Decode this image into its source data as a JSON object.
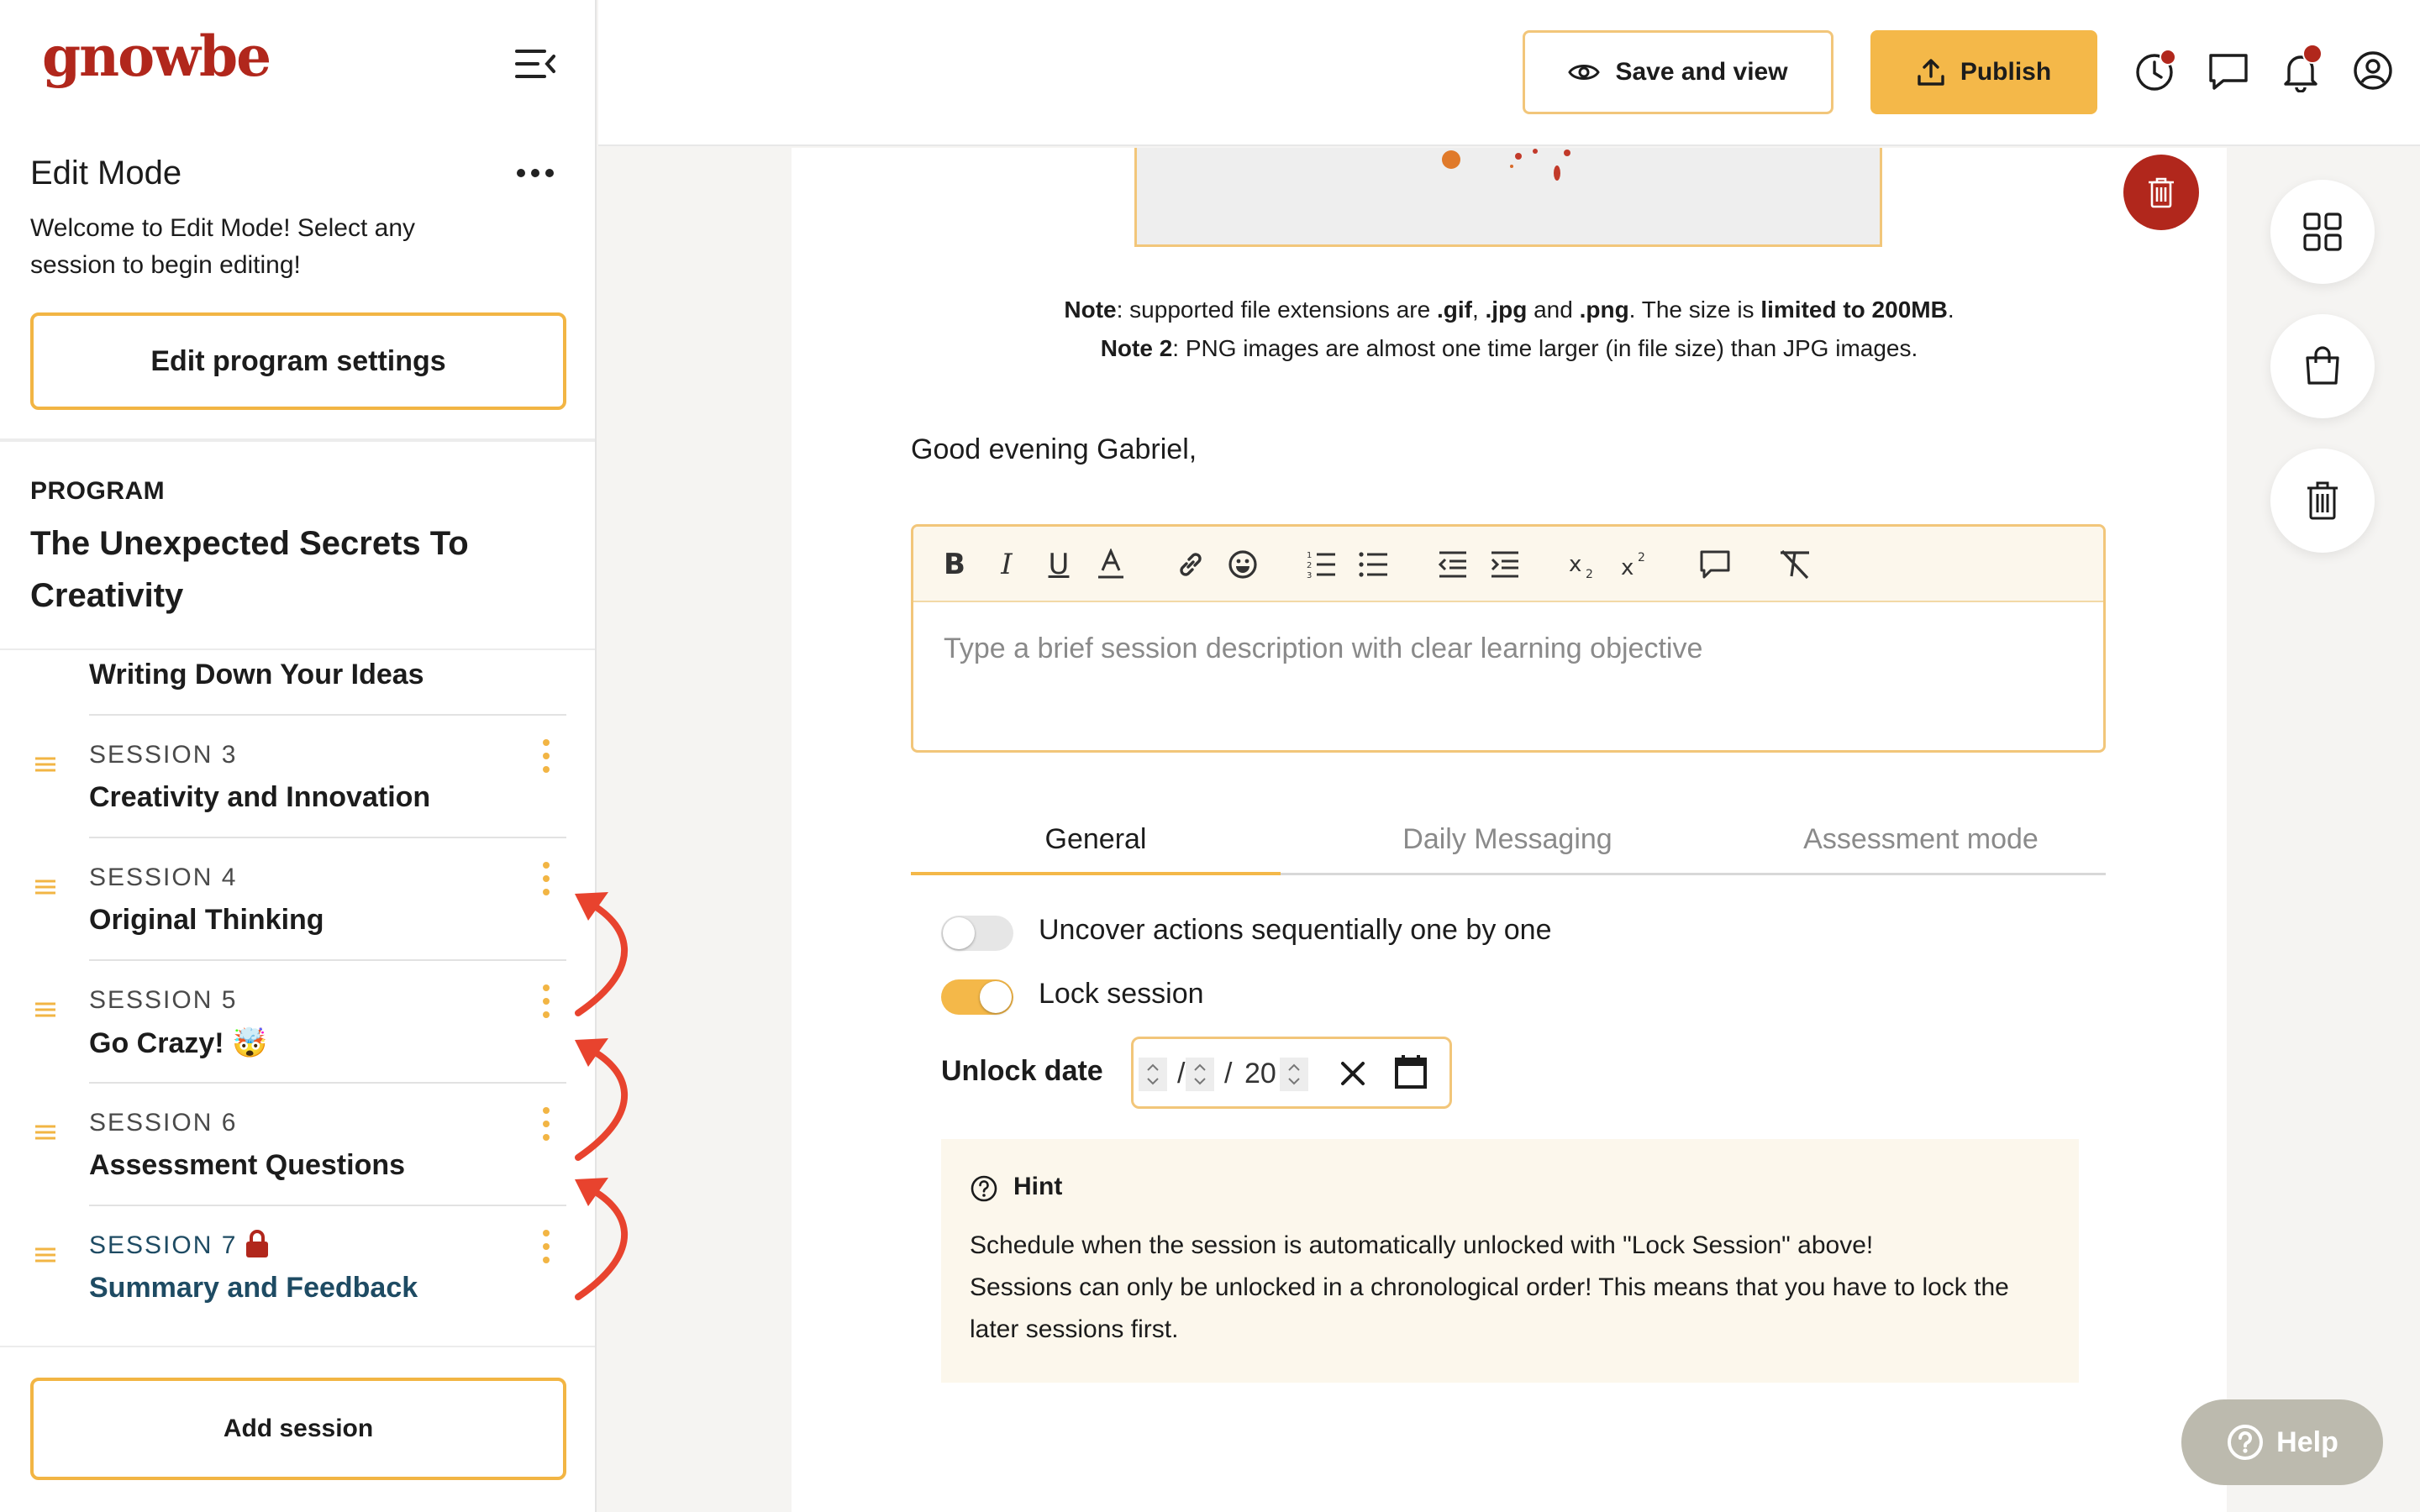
{
  "brand": {
    "logo_text": "gnowbe",
    "accent": "#f4b849",
    "brand_red": "#b1271c"
  },
  "sidebar": {
    "edit_title": "Edit Mode",
    "edit_desc": "Welcome to Edit Mode! Select any session to begin editing!",
    "settings_button": "Edit program settings",
    "program_label": "PROGRAM",
    "program_title": "The Unexpected Secrets To Creativity",
    "prev_session_title": "Writing Down Your Ideas",
    "sessions": [
      {
        "number": "SESSION 3",
        "title": "Creativity and Innovation"
      },
      {
        "number": "SESSION 4",
        "title": "Original Thinking"
      },
      {
        "number": "SESSION 5",
        "title": "Go Crazy! 🤯"
      },
      {
        "number": "SESSION 6",
        "title": "Assessment Questions"
      },
      {
        "number": "SESSION 7",
        "title": "Summary and Feedback"
      }
    ],
    "add_session_button": "Add session"
  },
  "header": {
    "save_view_button": "Save and view",
    "publish_button": "Publish"
  },
  "main": {
    "note1": {
      "label": "Note",
      "text1": ": supported file extensions are ",
      "ext_gif": ".gif",
      "sep1": ", ",
      "ext_jpg": ".jpg",
      "sep2": " and ",
      "ext_png": ".png",
      "text2": ". The size is ",
      "limit": "limited to 200MB",
      "end": "."
    },
    "note2": {
      "label": "Note 2",
      "text": ": PNG images are almost one time larger (in file size) than JPG images."
    },
    "greeting": "Good evening Gabriel,",
    "editor_placeholder": "Type a brief session description with clear learning objective",
    "tabs": [
      "General",
      "Daily Messaging",
      "Assessment mode"
    ],
    "toggle_sequential": {
      "label": "Uncover actions sequentially one by one",
      "on": false
    },
    "toggle_lock": {
      "label": "Lock session",
      "on": true
    },
    "unlock_date_label": "Unlock date",
    "date_sep1": "/",
    "date_sep2": "/",
    "date_year_prefix": "20",
    "hint": {
      "title": "Hint",
      "body1": "Schedule when the session is automatically unlocked with \"Lock Session\" above!",
      "body2": "Sessions can only be unlocked in a chronological order! This means that you have to lock the later sessions first."
    }
  },
  "help_button": "Help"
}
